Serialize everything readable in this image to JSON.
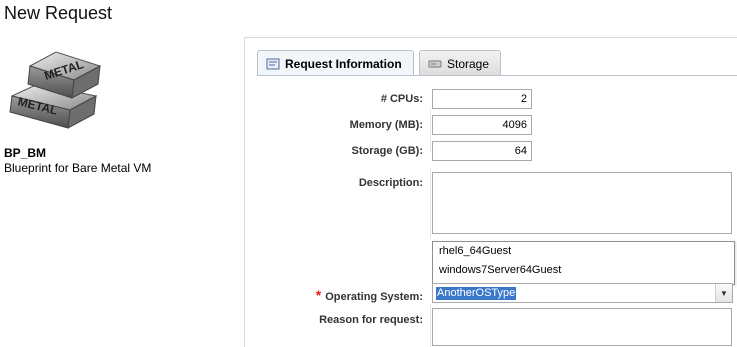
{
  "page": {
    "title": "New Request"
  },
  "blueprint": {
    "logo_text_top": "METAL",
    "logo_text_bottom": "METAL",
    "name": "BP_BM",
    "description": "Blueprint for Bare Metal VM"
  },
  "tabs": [
    {
      "label": "Request Information",
      "icon": "request-info-icon",
      "active": true
    },
    {
      "label": "Storage",
      "icon": "storage-icon",
      "active": false
    }
  ],
  "form": {
    "cpus": {
      "label": "# CPUs:",
      "value": "2"
    },
    "memory": {
      "label": "Memory (MB):",
      "value": "4096"
    },
    "storage": {
      "label": "Storage (GB):",
      "value": "64"
    },
    "description": {
      "label": "Description:",
      "value": ""
    },
    "operating_system": {
      "label": "Operating System:",
      "required": true,
      "value": "AnotherOSType",
      "options": [
        "rhel6_64Guest",
        "windows7Server64Guest"
      ]
    },
    "reason": {
      "label": "Reason for request:",
      "value": ""
    }
  },
  "colors": {
    "selection": "#3a78c9",
    "required": "#dd2222",
    "border": "#a9a9a9"
  }
}
